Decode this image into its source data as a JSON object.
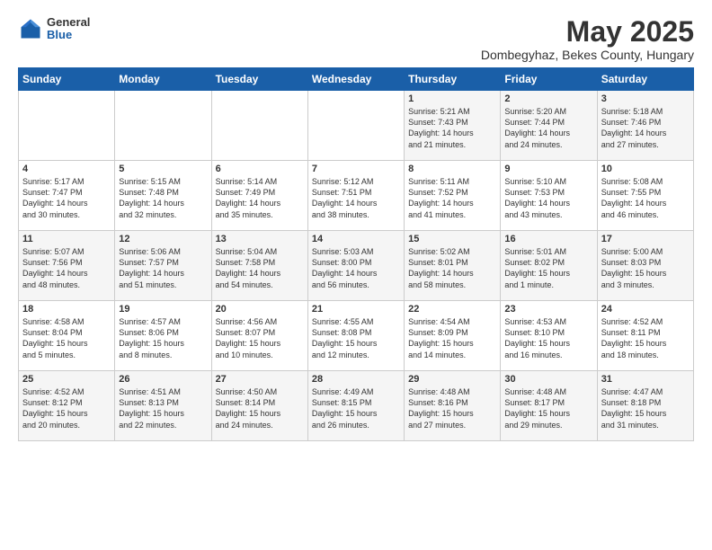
{
  "logo": {
    "general": "General",
    "blue": "Blue"
  },
  "title": "May 2025",
  "subtitle": "Dombegyhaz, Bekes County, Hungary",
  "headers": [
    "Sunday",
    "Monday",
    "Tuesday",
    "Wednesday",
    "Thursday",
    "Friday",
    "Saturday"
  ],
  "weeks": [
    [
      {
        "day": "",
        "content": ""
      },
      {
        "day": "",
        "content": ""
      },
      {
        "day": "",
        "content": ""
      },
      {
        "day": "",
        "content": ""
      },
      {
        "day": "1",
        "content": "Sunrise: 5:21 AM\nSunset: 7:43 PM\nDaylight: 14 hours\nand 21 minutes."
      },
      {
        "day": "2",
        "content": "Sunrise: 5:20 AM\nSunset: 7:44 PM\nDaylight: 14 hours\nand 24 minutes."
      },
      {
        "day": "3",
        "content": "Sunrise: 5:18 AM\nSunset: 7:46 PM\nDaylight: 14 hours\nand 27 minutes."
      }
    ],
    [
      {
        "day": "4",
        "content": "Sunrise: 5:17 AM\nSunset: 7:47 PM\nDaylight: 14 hours\nand 30 minutes."
      },
      {
        "day": "5",
        "content": "Sunrise: 5:15 AM\nSunset: 7:48 PM\nDaylight: 14 hours\nand 32 minutes."
      },
      {
        "day": "6",
        "content": "Sunrise: 5:14 AM\nSunset: 7:49 PM\nDaylight: 14 hours\nand 35 minutes."
      },
      {
        "day": "7",
        "content": "Sunrise: 5:12 AM\nSunset: 7:51 PM\nDaylight: 14 hours\nand 38 minutes."
      },
      {
        "day": "8",
        "content": "Sunrise: 5:11 AM\nSunset: 7:52 PM\nDaylight: 14 hours\nand 41 minutes."
      },
      {
        "day": "9",
        "content": "Sunrise: 5:10 AM\nSunset: 7:53 PM\nDaylight: 14 hours\nand 43 minutes."
      },
      {
        "day": "10",
        "content": "Sunrise: 5:08 AM\nSunset: 7:55 PM\nDaylight: 14 hours\nand 46 minutes."
      }
    ],
    [
      {
        "day": "11",
        "content": "Sunrise: 5:07 AM\nSunset: 7:56 PM\nDaylight: 14 hours\nand 48 minutes."
      },
      {
        "day": "12",
        "content": "Sunrise: 5:06 AM\nSunset: 7:57 PM\nDaylight: 14 hours\nand 51 minutes."
      },
      {
        "day": "13",
        "content": "Sunrise: 5:04 AM\nSunset: 7:58 PM\nDaylight: 14 hours\nand 54 minutes."
      },
      {
        "day": "14",
        "content": "Sunrise: 5:03 AM\nSunset: 8:00 PM\nDaylight: 14 hours\nand 56 minutes."
      },
      {
        "day": "15",
        "content": "Sunrise: 5:02 AM\nSunset: 8:01 PM\nDaylight: 14 hours\nand 58 minutes."
      },
      {
        "day": "16",
        "content": "Sunrise: 5:01 AM\nSunset: 8:02 PM\nDaylight: 15 hours\nand 1 minute."
      },
      {
        "day": "17",
        "content": "Sunrise: 5:00 AM\nSunset: 8:03 PM\nDaylight: 15 hours\nand 3 minutes."
      }
    ],
    [
      {
        "day": "18",
        "content": "Sunrise: 4:58 AM\nSunset: 8:04 PM\nDaylight: 15 hours\nand 5 minutes."
      },
      {
        "day": "19",
        "content": "Sunrise: 4:57 AM\nSunset: 8:06 PM\nDaylight: 15 hours\nand 8 minutes."
      },
      {
        "day": "20",
        "content": "Sunrise: 4:56 AM\nSunset: 8:07 PM\nDaylight: 15 hours\nand 10 minutes."
      },
      {
        "day": "21",
        "content": "Sunrise: 4:55 AM\nSunset: 8:08 PM\nDaylight: 15 hours\nand 12 minutes."
      },
      {
        "day": "22",
        "content": "Sunrise: 4:54 AM\nSunset: 8:09 PM\nDaylight: 15 hours\nand 14 minutes."
      },
      {
        "day": "23",
        "content": "Sunrise: 4:53 AM\nSunset: 8:10 PM\nDaylight: 15 hours\nand 16 minutes."
      },
      {
        "day": "24",
        "content": "Sunrise: 4:52 AM\nSunset: 8:11 PM\nDaylight: 15 hours\nand 18 minutes."
      }
    ],
    [
      {
        "day": "25",
        "content": "Sunrise: 4:52 AM\nSunset: 8:12 PM\nDaylight: 15 hours\nand 20 minutes."
      },
      {
        "day": "26",
        "content": "Sunrise: 4:51 AM\nSunset: 8:13 PM\nDaylight: 15 hours\nand 22 minutes."
      },
      {
        "day": "27",
        "content": "Sunrise: 4:50 AM\nSunset: 8:14 PM\nDaylight: 15 hours\nand 24 minutes."
      },
      {
        "day": "28",
        "content": "Sunrise: 4:49 AM\nSunset: 8:15 PM\nDaylight: 15 hours\nand 26 minutes."
      },
      {
        "day": "29",
        "content": "Sunrise: 4:48 AM\nSunset: 8:16 PM\nDaylight: 15 hours\nand 27 minutes."
      },
      {
        "day": "30",
        "content": "Sunrise: 4:48 AM\nSunset: 8:17 PM\nDaylight: 15 hours\nand 29 minutes."
      },
      {
        "day": "31",
        "content": "Sunrise: 4:47 AM\nSunset: 8:18 PM\nDaylight: 15 hours\nand 31 minutes."
      }
    ]
  ]
}
